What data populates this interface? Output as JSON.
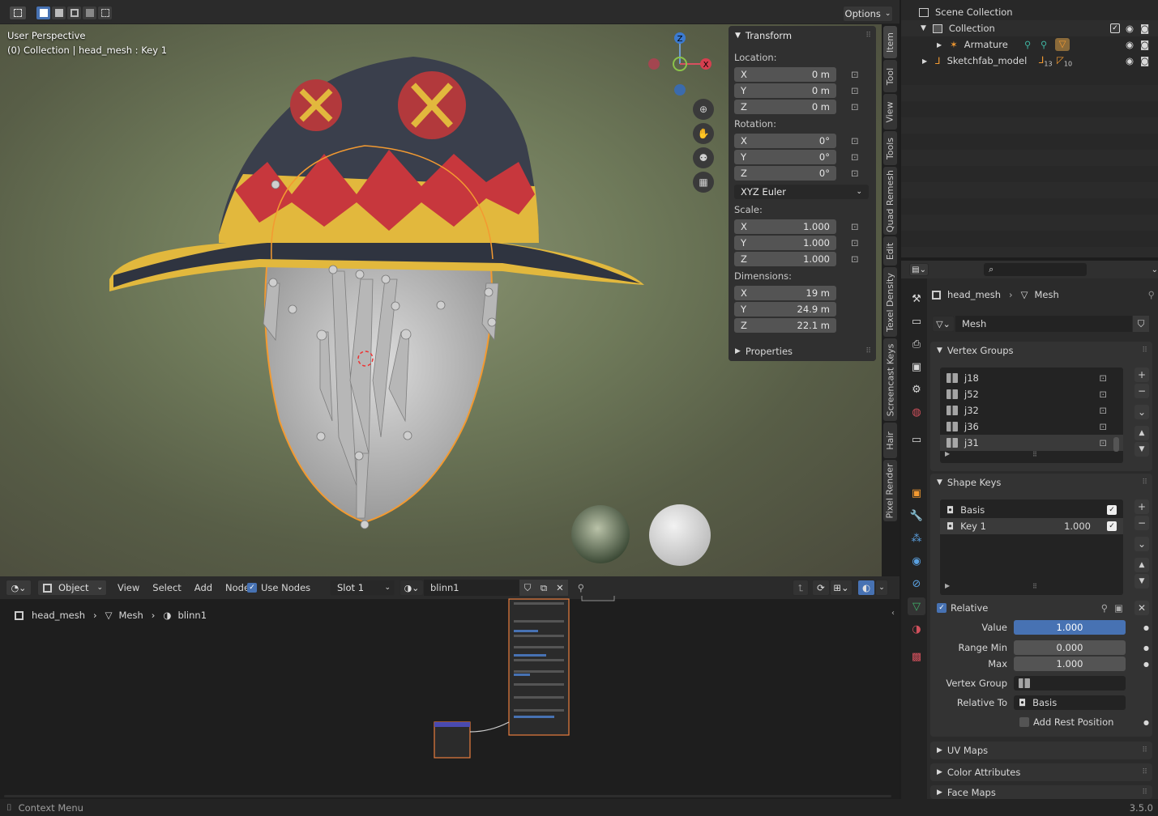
{
  "viewport": {
    "perspective_label": "User Perspective",
    "object_label": "(0) Collection | head_mesh : Key 1",
    "options_label": "Options",
    "gizmo": {
      "x": "X",
      "y": "Y",
      "z": "Z"
    }
  },
  "npanel": {
    "header": "Transform",
    "location_label": "Location:",
    "location": [
      {
        "axis": "X",
        "value": "0 m"
      },
      {
        "axis": "Y",
        "value": "0 m"
      },
      {
        "axis": "Z",
        "value": "0 m"
      }
    ],
    "rotation_label": "Rotation:",
    "rotation": [
      {
        "axis": "X",
        "value": "0°"
      },
      {
        "axis": "Y",
        "value": "0°"
      },
      {
        "axis": "Z",
        "value": "0°"
      }
    ],
    "rotation_mode": "XYZ Euler",
    "scale_label": "Scale:",
    "scale": [
      {
        "axis": "X",
        "value": "1.000"
      },
      {
        "axis": "Y",
        "value": "1.000"
      },
      {
        "axis": "Z",
        "value": "1.000"
      }
    ],
    "dimensions_label": "Dimensions:",
    "dimensions": [
      {
        "axis": "X",
        "value": "19 m"
      },
      {
        "axis": "Y",
        "value": "24.9 m"
      },
      {
        "axis": "Z",
        "value": "22.1 m"
      }
    ],
    "properties_label": "Properties"
  },
  "vtabs": [
    "Item",
    "Tool",
    "View",
    "Tools",
    "Quad Remesh",
    "Edit",
    "Texel Density",
    "Screencast Keys",
    "Hair",
    "Pixel Render"
  ],
  "outliner": {
    "scene_collection": "Scene Collection",
    "collection": "Collection",
    "items": [
      {
        "name": "Armature"
      },
      {
        "name": "Sketchfab_model",
        "badge1": "13",
        "badge2": "10"
      }
    ]
  },
  "properties": {
    "object_name": "head_mesh",
    "data_type": "Mesh",
    "mesh_name": "Mesh",
    "vertex_groups_label": "Vertex Groups",
    "vertex_groups": [
      "j18",
      "j52",
      "j32",
      "j36",
      "j31"
    ],
    "shape_keys_label": "Shape Keys",
    "shape_keys": [
      {
        "name": "Basis",
        "value": ""
      },
      {
        "name": "Key 1",
        "value": "1.000"
      }
    ],
    "relative_label": "Relative",
    "value_label": "Value",
    "value": "1.000",
    "value_fraction": 1.0,
    "range_min_label": "Range Min",
    "range_min": "0.000",
    "max_label": "Max",
    "max": "1.000",
    "vertex_group_label": "Vertex Group",
    "relative_to_label": "Relative To",
    "relative_to": "Basis",
    "add_rest_label": "Add Rest Position",
    "uv_maps_label": "UV Maps",
    "color_attr_label": "Color Attributes",
    "face_maps_label": "Face Maps"
  },
  "node_editor": {
    "mode": "Object",
    "menus": [
      "View",
      "Select",
      "Add",
      "Node"
    ],
    "use_nodes": "Use Nodes",
    "slot": "Slot 1",
    "material": "blinn1",
    "breadcrumb": [
      "head_mesh",
      "Mesh",
      "blinn1"
    ]
  },
  "status": {
    "left": "Context Menu",
    "version": "3.5.0"
  }
}
